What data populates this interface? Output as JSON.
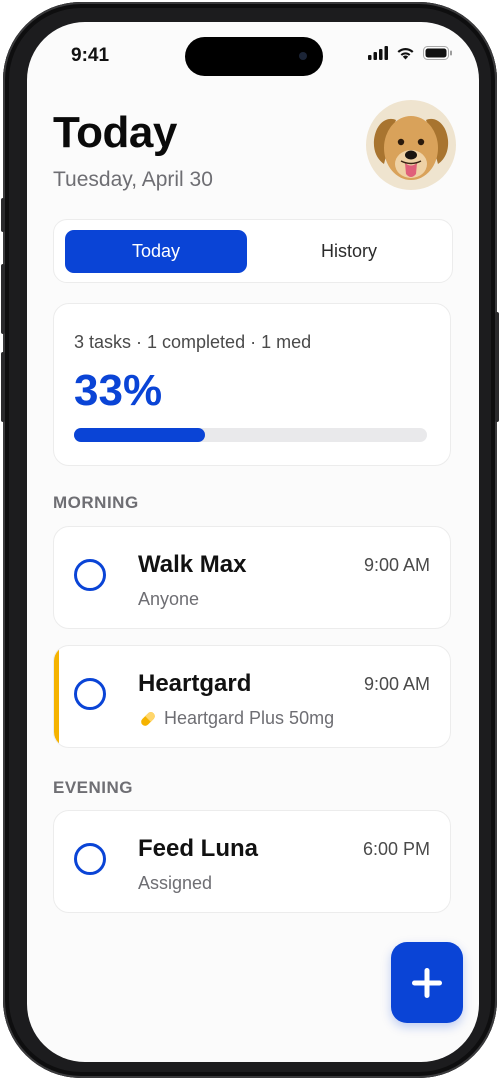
{
  "status_bar": {
    "time": "9:41",
    "icons": [
      "signal-icon",
      "wifi-icon",
      "battery-icon"
    ]
  },
  "header": {
    "title": "Today",
    "date": "Tuesday, April 30",
    "avatar": "dog-avatar"
  },
  "tabs": [
    {
      "label": "Today",
      "active": true
    },
    {
      "label": "History",
      "active": false
    }
  ],
  "progress": {
    "summary": "3 tasks · 1 completed · 1 med",
    "percent_label": "33%",
    "fraction": 0.37
  },
  "sections": {
    "morning": {
      "label": "MORNING",
      "tasks": [
        {
          "name": "Walk Max",
          "subtitle": "Anyone",
          "time": "9:00 AM",
          "completed": false
        },
        {
          "name": "Heartgard",
          "subtitle": "Heartgard Plus 50mg",
          "time": "9:00 AM",
          "completed": false,
          "medication": true,
          "icon": "pill-icon",
          "accent_color": "#f5b300"
        }
      ]
    },
    "evening": {
      "label": "EVENING",
      "tasks": [
        {
          "name": "Feed Luna",
          "subtitle": "Assigned",
          "time": "6:00 PM",
          "completed": false
        }
      ]
    }
  },
  "fab": {
    "icon": "plus-icon"
  },
  "colors": {
    "accent": "#0a44d6",
    "medication": "#f5b300",
    "background": "#fbfbfb"
  }
}
